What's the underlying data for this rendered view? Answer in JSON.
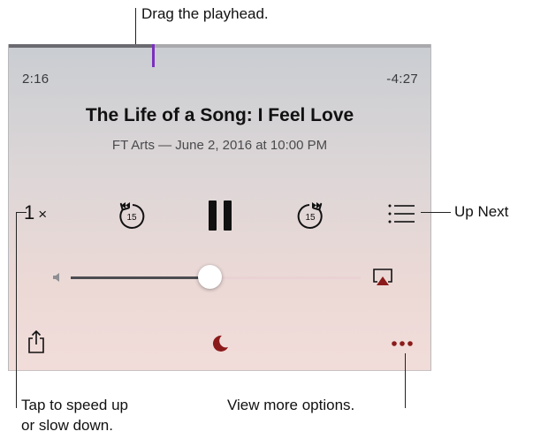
{
  "player": {
    "elapsed_time": "2:16",
    "remaining_time": "-4:27",
    "title": "The Life of a Song: I Feel Love",
    "subtitle": "FT Arts — June 2, 2016 at 10:00 PM",
    "playback_progress": 0.34,
    "speed": {
      "value": "1",
      "unit": "×"
    },
    "skip_back_seconds": "15",
    "skip_forward_seconds": "15",
    "volume_level": 0.48,
    "icons": {
      "skip_back": "skip-back-15-icon",
      "pause": "pause-icon",
      "skip_forward": "skip-forward-15-icon",
      "up_next": "list-icon",
      "volume_low": "speaker-low-icon",
      "airplay": "airplay-icon",
      "share": "share-icon",
      "sleep_timer": "moon-icon",
      "more": "ellipsis-icon"
    },
    "colors": {
      "accent": "#8b1a1a",
      "playhead": "#7b2fbf"
    }
  },
  "callouts": {
    "playhead": "Drag the playhead.",
    "up_next": "Up Next",
    "speed_line1": "Tap to speed up",
    "speed_line2": "or slow down.",
    "more_options": "View more options."
  }
}
